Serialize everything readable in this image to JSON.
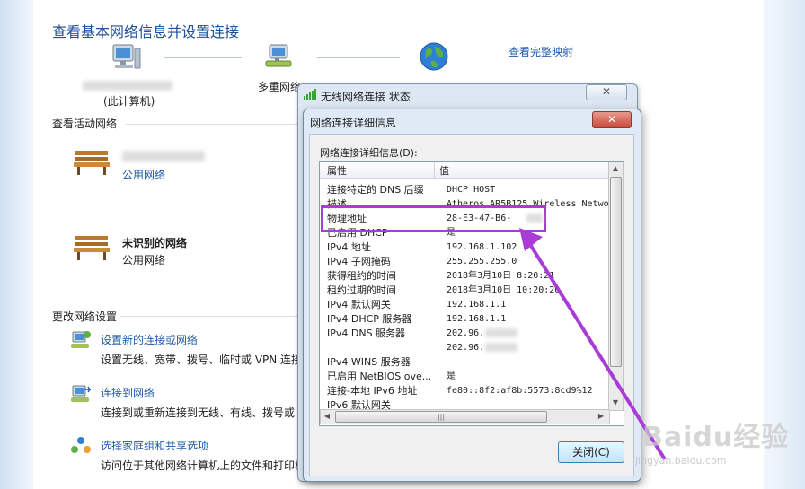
{
  "page": {
    "title": "查看基本网络信息并设置连接",
    "full_map_link": "查看完整映射",
    "this_computer_label": "(此计算机)",
    "multi_network_label": "多重网络",
    "active_networks_heading": "查看活动网络",
    "network1": {
      "type_link": "公用网络"
    },
    "network2": {
      "name": "未识别的网络",
      "type": "公用网络"
    },
    "change_settings_heading": "更改网络设置",
    "tasks": [
      {
        "title": "设置新的连接或网络",
        "desc": "设置无线、宽带、拨号、临时或 VPN 连接"
      },
      {
        "title": "连接到网络",
        "desc": "连接到或重新连接到无线、有线、拨号或"
      },
      {
        "title": "选择家庭组和共享选项",
        "desc": "访问位于其他网络计算机上的文件和打印机"
      }
    ]
  },
  "status_dialog": {
    "title": "无线网络连接 状态"
  },
  "details_dialog": {
    "title": "网络连接详细信息",
    "section_label": "网络连接详细信息(D):",
    "col_property": "属性",
    "col_value": "值",
    "rows": [
      {
        "k": "连接特定的 DNS 后缀",
        "v": "DHCP HOST"
      },
      {
        "k": "描述",
        "v": "Atheros AR5B125 Wireless Netwo"
      },
      {
        "k": "物理地址",
        "v": "28-E3-47-B6-"
      },
      {
        "k": "已启用 DHCP",
        "v": "是"
      },
      {
        "k": "IPv4 地址",
        "v": "192.168.1.102"
      },
      {
        "k": "IPv4 子网掩码",
        "v": "255.255.255.0"
      },
      {
        "k": "获得租约的时间",
        "v": "2018年3月10日 8:20:21"
      },
      {
        "k": "租约过期的时间",
        "v": "2018年3月10日 10:20:20"
      },
      {
        "k": "IPv4 默认网关",
        "v": "192.168.1.1"
      },
      {
        "k": "IPv4 DHCP 服务器",
        "v": "192.168.1.1"
      },
      {
        "k": "IPv4 DNS 服务器",
        "v": "202.96."
      },
      {
        "k": "",
        "v": "202.96."
      },
      {
        "k": "IPv4 WINS 服务器",
        "v": ""
      },
      {
        "k": "已启用 NetBIOS ove...",
        "v": "是"
      },
      {
        "k": "连接-本地 IPv6 地址",
        "v": "fe80::8f2:af8b:5573:8cd9%12"
      },
      {
        "k": "IPv6 默认网关",
        "v": ""
      }
    ],
    "close_button": "关闭(C)"
  },
  "watermark": {
    "text": "Baidu经验",
    "sub": "jingyan.baidu.com"
  },
  "colors": {
    "link": "#1f5aa8",
    "highlight": "#a93bd6",
    "title_close": "#c9483a"
  },
  "icons": [
    "computer-icon",
    "network-icon",
    "globe-icon",
    "bench-icon",
    "signal-icon",
    "setup-connection-icon",
    "connect-network-icon",
    "homegroup-icon"
  ]
}
